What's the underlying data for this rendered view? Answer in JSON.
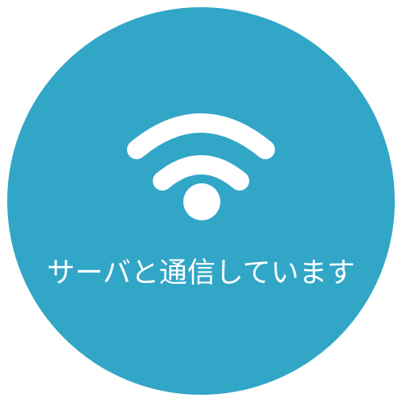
{
  "badge": {
    "background_color": "#32a6c6",
    "icon": "wifi-icon",
    "icon_color": "#ffffff",
    "status_text": "サーバと通信しています"
  }
}
